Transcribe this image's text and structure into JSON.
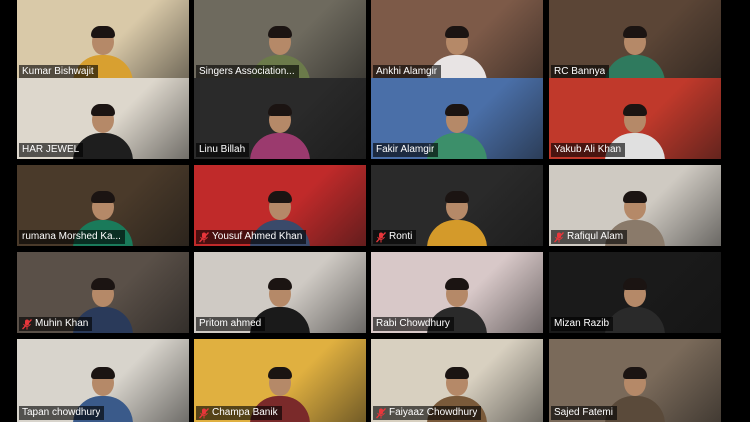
{
  "participants": [
    {
      "name": "Kumar Bishwajit",
      "muted": false,
      "bg": "#d9c9a8",
      "shirt": "#d8a030"
    },
    {
      "name": "Singers Association...",
      "muted": false,
      "bg": "#6e6a5e",
      "shirt": "#6b7a4a"
    },
    {
      "name": "Ankhi Alamgir",
      "muted": false,
      "bg": "#7d5a48",
      "shirt": "#e8e4e4"
    },
    {
      "name": "RC Bannya",
      "muted": false,
      "bg": "#5b4536",
      "shirt": "#2f7a5e"
    },
    {
      "name": "HAR JEWEL",
      "muted": false,
      "active": true,
      "bg": "#ddd7cc",
      "shirt": "#1e1e1e"
    },
    {
      "name": "Linu Billah",
      "muted": false,
      "bg": "#2a2a2a",
      "shirt": "#9b3a6e"
    },
    {
      "name": "Fakir Alamgir",
      "muted": false,
      "bg": "#4a6fa8",
      "shirt": "#3c8f6a"
    },
    {
      "name": "Yakub Ali Khan",
      "muted": false,
      "bg": "#c0392b",
      "shirt": "#e0e0e0"
    },
    {
      "name": "rumana Morshed Ka...",
      "muted": false,
      "bg": "#4a3a2a",
      "shirt": "#1a7a5a"
    },
    {
      "name": "Yousuf Ahmed Khan",
      "muted": true,
      "bg": "#c02a2a",
      "shirt": "#3a4a6a"
    },
    {
      "name": "Ronti",
      "muted": true,
      "bg": "#2a2a2a",
      "shirt": "#d49a2a"
    },
    {
      "name": "Rafiqul Alam",
      "muted": true,
      "bg": "#cfcac2",
      "shirt": "#8a7a6a"
    },
    {
      "name": "Muhin Khan",
      "muted": true,
      "bg": "#5a5048",
      "shirt": "#2a3a5a"
    },
    {
      "name": "Pritom ahmed",
      "muted": false,
      "bg": "#cfcac4",
      "shirt": "#1a1a1a"
    },
    {
      "name": "Rabi Chowdhury",
      "muted": false,
      "bg": "#d8c8c8",
      "shirt": "#2a2a2a"
    },
    {
      "name": "Mizan Razib",
      "muted": false,
      "bg": "#1a1a1a",
      "shirt": "#2a2a2a"
    },
    {
      "name": "Tapan chowdhury",
      "muted": false,
      "bg": "#d8d4cc",
      "shirt": "#3a5a8a"
    },
    {
      "name": "Champa Banik",
      "muted": true,
      "bg": "#e0b040",
      "shirt": "#7a2a2a"
    },
    {
      "name": "Faiyaaz Chowdhury",
      "muted": true,
      "bg": "#d8d0c0",
      "shirt": "#7a5a3a"
    },
    {
      "name": "Sajed Fatemi",
      "muted": false,
      "bg": "#7a6a5a",
      "shirt": "#5a4a3a"
    }
  ],
  "icons": {
    "muted_mic": "mic-off-icon"
  },
  "colors": {
    "active_speaker_border": "#8bd36b",
    "mute_icon": "#e8363b"
  }
}
